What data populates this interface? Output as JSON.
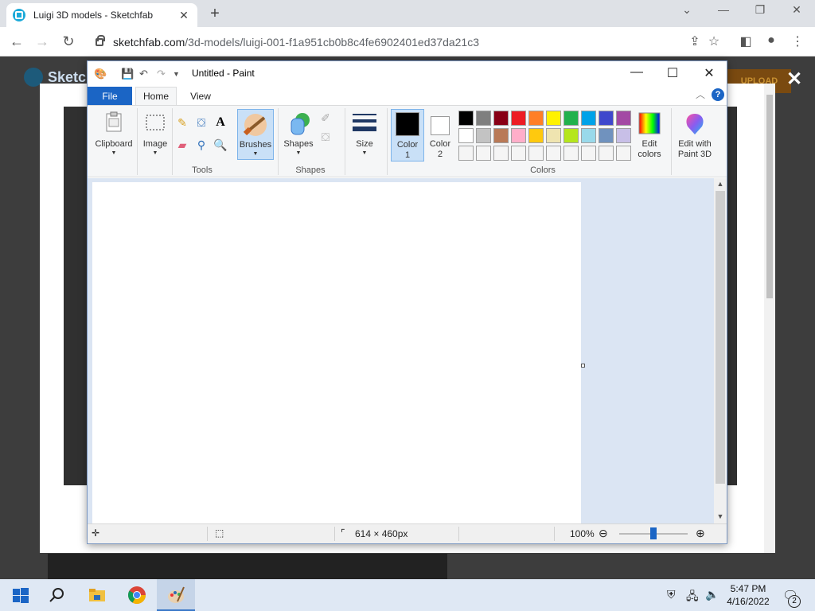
{
  "browser": {
    "tab_title": "Luigi 3D models - Sketchfab",
    "url_host": "sketchfab.com",
    "url_path": "/3d-models/luigi-001-f1a951cb0b8c4fe6902401ed37da21c3"
  },
  "page": {
    "site_name": "Sketc",
    "upload_label": "UPLOAD",
    "close_glyph": "✕"
  },
  "paint": {
    "title": "Untitled - Paint",
    "tabs": {
      "file": "File",
      "home": "Home",
      "view": "View"
    },
    "help_glyph": "?",
    "groups": {
      "clipboard": "Clipboard",
      "image": "Image",
      "tools": "Tools",
      "brushes": "Brushes",
      "shapes_btn": "Shapes",
      "shapes": "Shapes",
      "size": "Size",
      "color1_a": "Color",
      "color1_b": "1",
      "color2_a": "Color",
      "color2_b": "2",
      "colors": "Colors",
      "edit_colors_a": "Edit",
      "edit_colors_b": "colors",
      "paint3d_a": "Edit with",
      "paint3d_b": "Paint 3D"
    },
    "palette_row1": [
      "#000000",
      "#7f7f7f",
      "#880015",
      "#ed1c24",
      "#ff7f27",
      "#fff200",
      "#22b14c",
      "#00a2e8",
      "#3f48cc",
      "#a349a4"
    ],
    "palette_row2": [
      "#ffffff",
      "#c3c3c3",
      "#b97a57",
      "#ffaec9",
      "#ffc90e",
      "#efe4b0",
      "#b5e61d",
      "#99d9ea",
      "#7092be",
      "#c8bfe7"
    ],
    "palette_row3": [
      "#f5f5f5",
      "#f5f5f5",
      "#f5f5f5",
      "#f5f5f5",
      "#f5f5f5",
      "#f5f5f5",
      "#f5f5f5",
      "#f5f5f5",
      "#f5f5f5",
      "#f5f5f5"
    ],
    "color1": "#000000",
    "color2": "#ffffff",
    "status": {
      "dimensions": "614 × 460px",
      "zoom": "100%"
    }
  },
  "taskbar": {
    "time": "5:47 PM",
    "date": "4/16/2022",
    "notifications": "2"
  }
}
